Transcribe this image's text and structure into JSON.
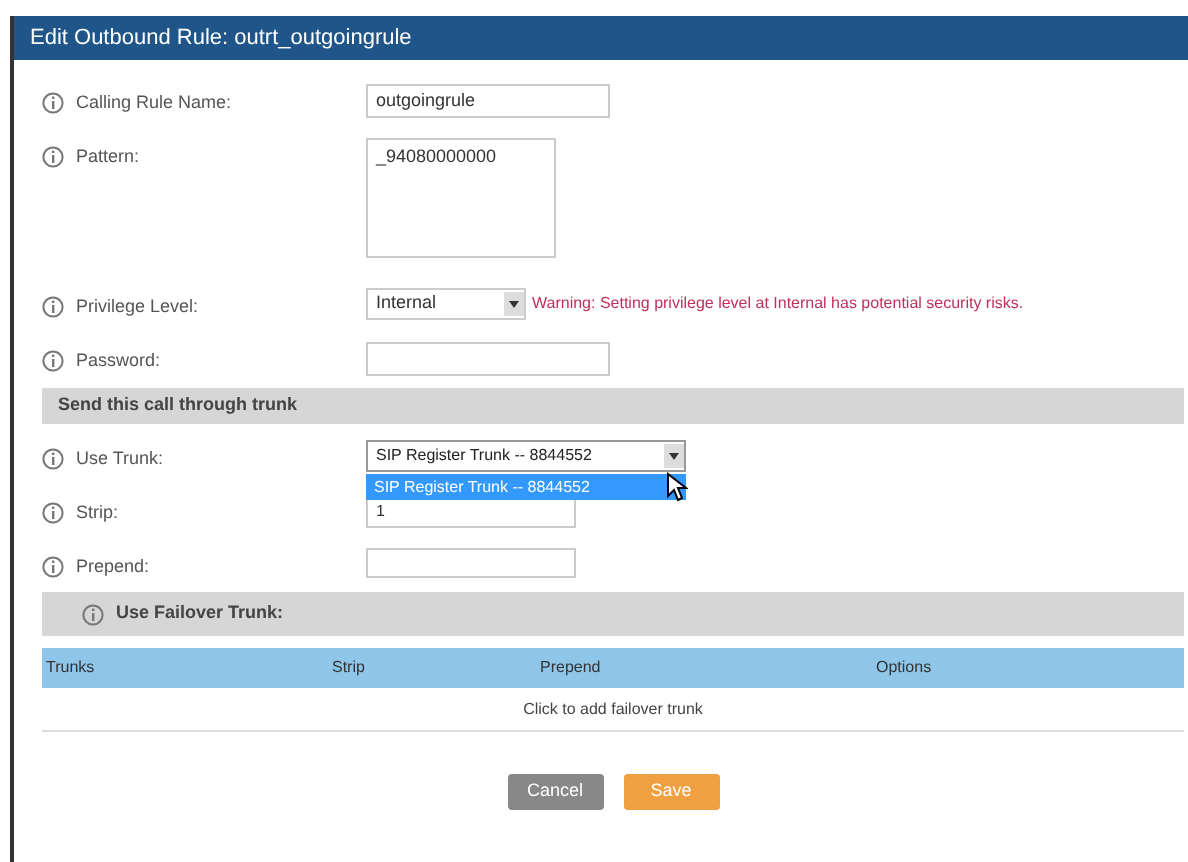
{
  "window": {
    "title": "Edit Outbound Rule: outrt_outgoingrule"
  },
  "fields": [
    {
      "kind": "text",
      "label": "Calling Rule Name:",
      "value": "outgoingrule"
    },
    {
      "kind": "textarea",
      "label": "Pattern:",
      "value": "_94080000000"
    },
    {
      "kind": "select",
      "label": "Privilege Level:",
      "value": "Internal",
      "warning": "Warning: Setting privilege level at Internal has potential security risks."
    },
    {
      "kind": "text",
      "label": "Password:"
    }
  ],
  "trunk_section": {
    "title": "Send this call through trunk",
    "use_trunk": {
      "label": "Use Trunk:",
      "value": "SIP Register Trunk -- 8844552",
      "options": [
        {
          "label": "SIP Register Trunk -- 8844552",
          "selected": true
        }
      ]
    },
    "strip": {
      "label": "Strip:",
      "value": "1"
    },
    "prepend": {
      "label": "Prepend:"
    }
  },
  "failover": {
    "title": "Use Failover Trunk:",
    "columns": [
      "Trunks",
      "Strip",
      "Prepend",
      "Options"
    ],
    "empty_text": "Click to add failover trunk"
  },
  "buttons": [
    {
      "kind": "cancel",
      "label": "Cancel"
    },
    {
      "kind": "save",
      "label": "Save"
    }
  ]
}
